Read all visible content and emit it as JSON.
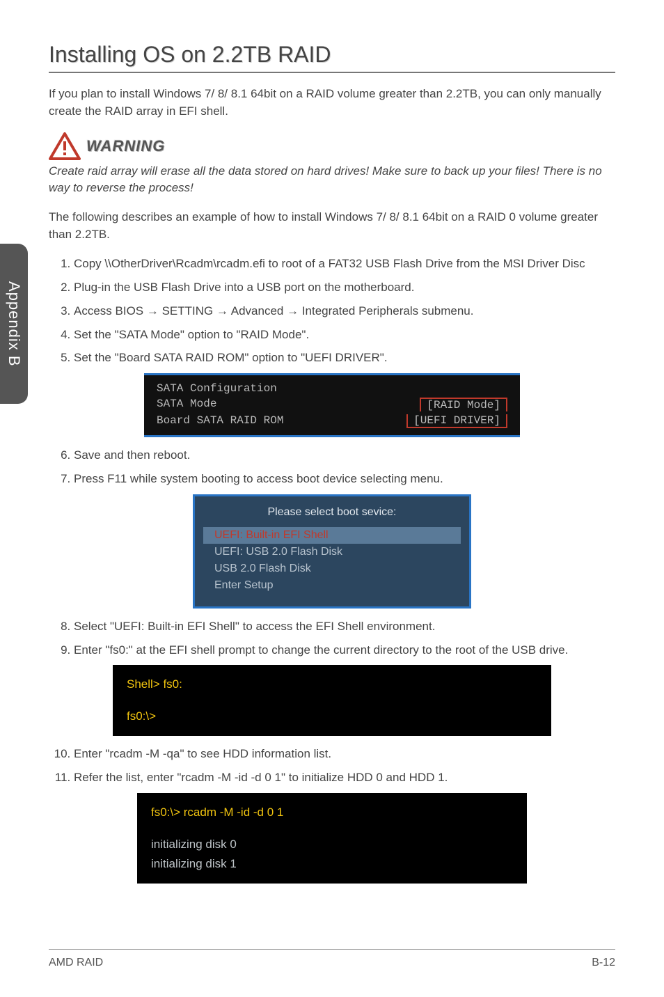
{
  "sideTab": "Appendix B",
  "title": "Installing OS on 2.2TB RAID",
  "intro": "If you plan to install Windows 7/ 8/ 8.1 64bit on a RAID volume greater than 2.2TB, you can only manually create the RAID array in EFI shell.",
  "warning": {
    "label": "WARNING",
    "text": "Create raid array will erase all the data stored on hard drives! Make sure to back up your files! There is no way to reverse the process!"
  },
  "desc": "The following describes an example of how to install Windows 7/ 8/ 8.1 64bit on a RAID 0 volume greater than 2.2TB.",
  "steps1": [
    "Copy \\\\OtherDriver\\Rcadm\\rcadm.efi to root of a FAT32 USB Flash Drive from the MSI Driver Disc",
    "Plug-in the USB Flash Drive into a USB port on the motherboard.",
    "Access BIOS → SETTING → Advanced → Integrated Peripherals submenu.",
    "Set the \"SATA Mode\" option to \"RAID Mode\".",
    "Set the \"Board SATA RAID ROM\" option to \"UEFI DRIVER\"."
  ],
  "bios": {
    "header": "SATA Configuration",
    "row1_label": "SATA Mode",
    "row1_value": "[RAID Mode]",
    "row2_label": "Board SATA RAID ROM",
    "row2_value": "[UEFI DRIVER]"
  },
  "steps2": [
    "Save and then reboot.",
    "Press F11 while system booting to access boot device selecting menu."
  ],
  "bootMenu": {
    "title": "Please select boot sevice:",
    "items": [
      {
        "label": "UEFI: Built-in EFI Shell",
        "selected": true
      },
      {
        "label": "UEFI: USB 2.0 Flash Disk",
        "selected": false
      },
      {
        "label": "USB 2.0 Flash Disk",
        "selected": false
      },
      {
        "label": "Enter Setup",
        "selected": false
      }
    ]
  },
  "steps3": [
    "Select \"UEFI: Built-in EFI Shell\" to access the EFI Shell environment.",
    "Enter \"fs0:\" at the EFI shell prompt to change the current directory to the root of the USB drive."
  ],
  "shell1": {
    "line1": "Shell> fs0:",
    "line2": "fs0:\\>"
  },
  "steps4": [
    "Enter \"rcadm -M -qa\" to see HDD information list.",
    "Refer the list, enter \"rcadm -M -id -d 0 1\" to initialize HDD 0 and HDD 1."
  ],
  "shell2": {
    "line1": "fs0:\\> rcadm -M -id -d 0 1",
    "line2": "initializing disk 0",
    "line3": "initializing disk 1"
  },
  "footer": {
    "left": "AMD RAID",
    "right": "B-12"
  }
}
